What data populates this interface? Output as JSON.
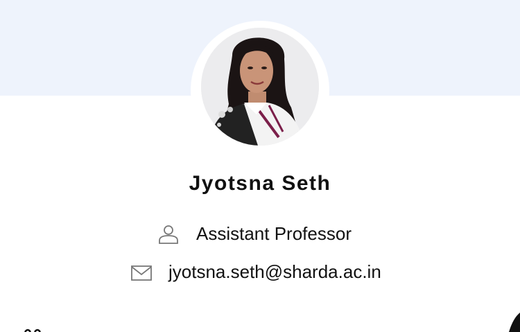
{
  "profile": {
    "name": "Jyotsna Seth",
    "title": "Assistant Professor",
    "email": "jyotsna.seth@sharda.ac.in",
    "avatar": "profile-photo"
  },
  "icons": {
    "title_icon": "person-icon",
    "email_icon": "mail-icon"
  },
  "colors": {
    "banner": "#eef3fc",
    "text": "#111111",
    "icon": "#777777",
    "background": "#ffffff"
  }
}
